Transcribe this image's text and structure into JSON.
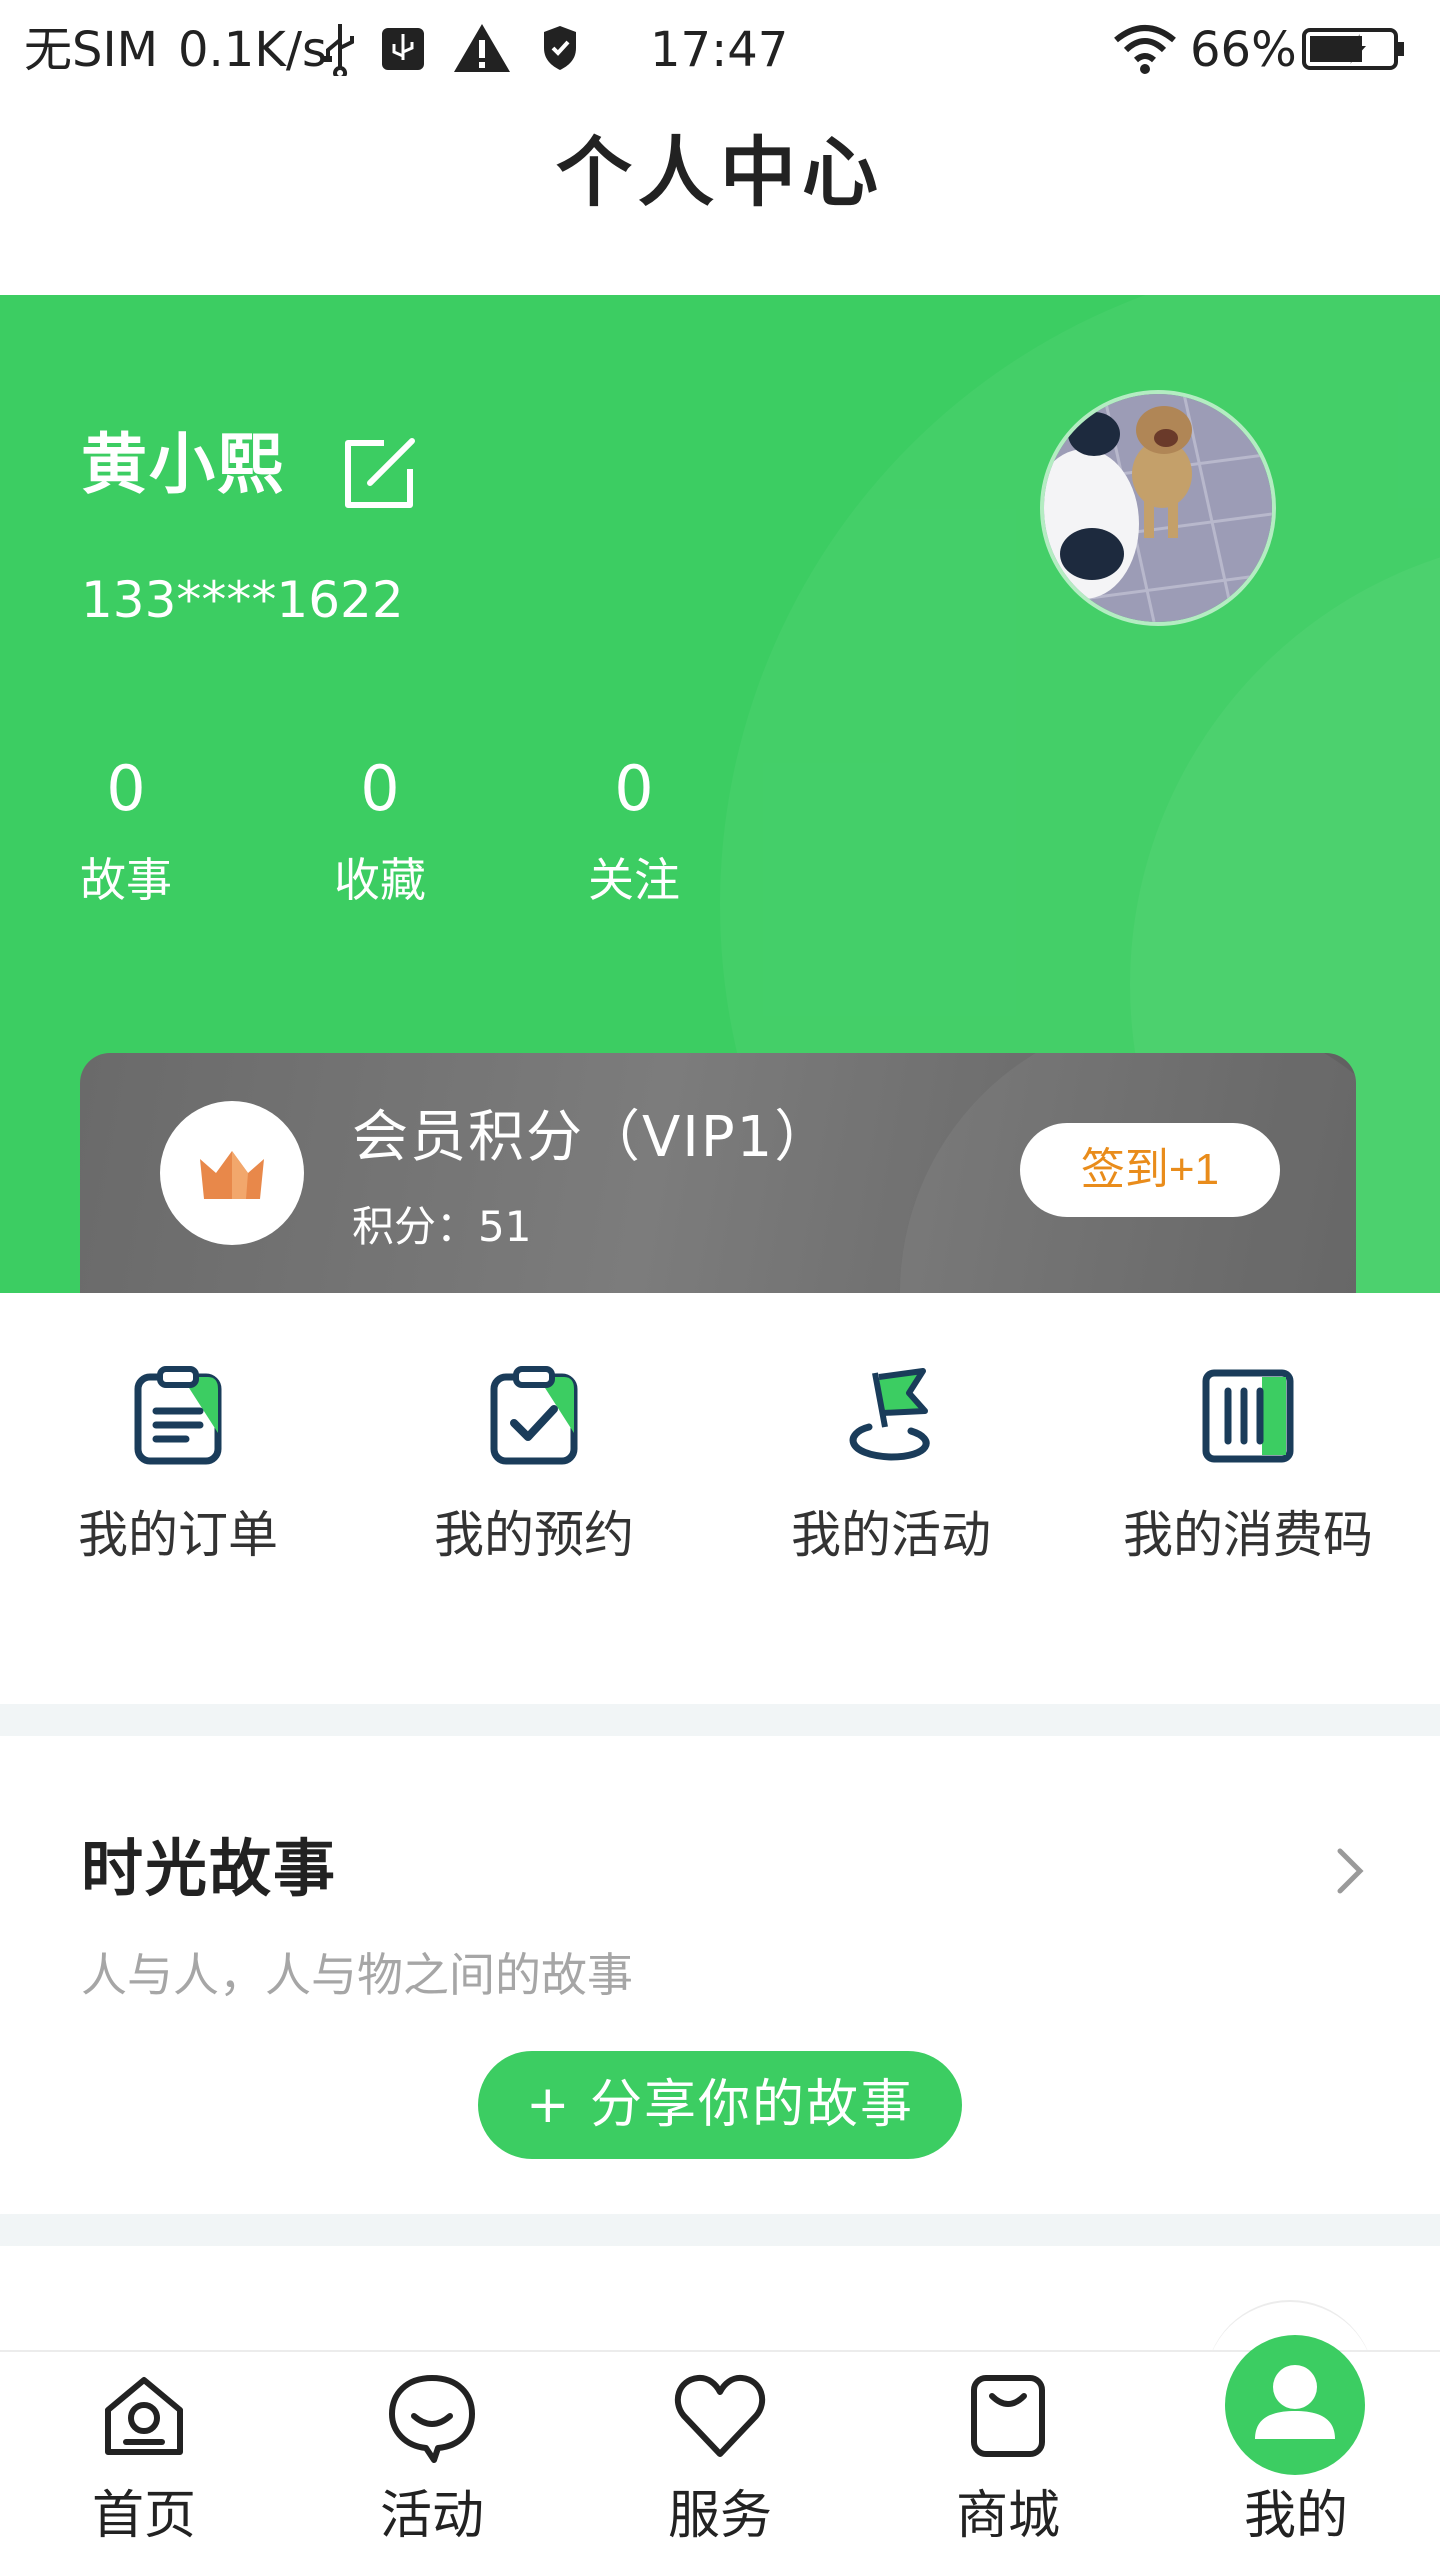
{
  "status_bar": {
    "carrier": "无SIM",
    "speed": "0.1K/s",
    "time": "17:47",
    "battery": "66%",
    "icons": [
      "usb-icon",
      "usb-debug-icon",
      "warning-icon",
      "shield-icon",
      "wifi-icon",
      "battery-icon"
    ]
  },
  "nav": {
    "title": "个人中心"
  },
  "profile": {
    "name": "黄小熙",
    "phone": "133****1622",
    "stats": [
      {
        "value": "0",
        "label": "故事"
      },
      {
        "value": "0",
        "label": "收藏"
      },
      {
        "value": "0",
        "label": "关注"
      }
    ]
  },
  "vip": {
    "title": "会员积分（VIP1）",
    "points": "积分：51",
    "sign_label": "签到+1"
  },
  "quick_actions": [
    {
      "label": "我的订单",
      "icon": "order-icon"
    },
    {
      "label": "我的预约",
      "icon": "reservation-icon"
    },
    {
      "label": "我的活动",
      "icon": "activity-flag-icon"
    },
    {
      "label": "我的消费码",
      "icon": "consumption-code-icon"
    }
  ],
  "story": {
    "title": "时光故事",
    "subtitle": "人与人，人与物之间的故事",
    "share_label": "+ 分享你的故事"
  },
  "tabs": [
    {
      "label": "首页",
      "icon": "home-icon"
    },
    {
      "label": "活动",
      "icon": "activity-icon"
    },
    {
      "label": "服务",
      "icon": "heart-icon"
    },
    {
      "label": "商城",
      "icon": "bag-icon"
    },
    {
      "label": "我的",
      "icon": "user-icon",
      "active": true
    }
  ],
  "colors": {
    "brand_green": "#3ccd62",
    "vip_orange": "#e98c1b",
    "icon_navy": "#1a3c5a",
    "text_dark": "#222222",
    "text_muted": "#a6a6a6"
  }
}
